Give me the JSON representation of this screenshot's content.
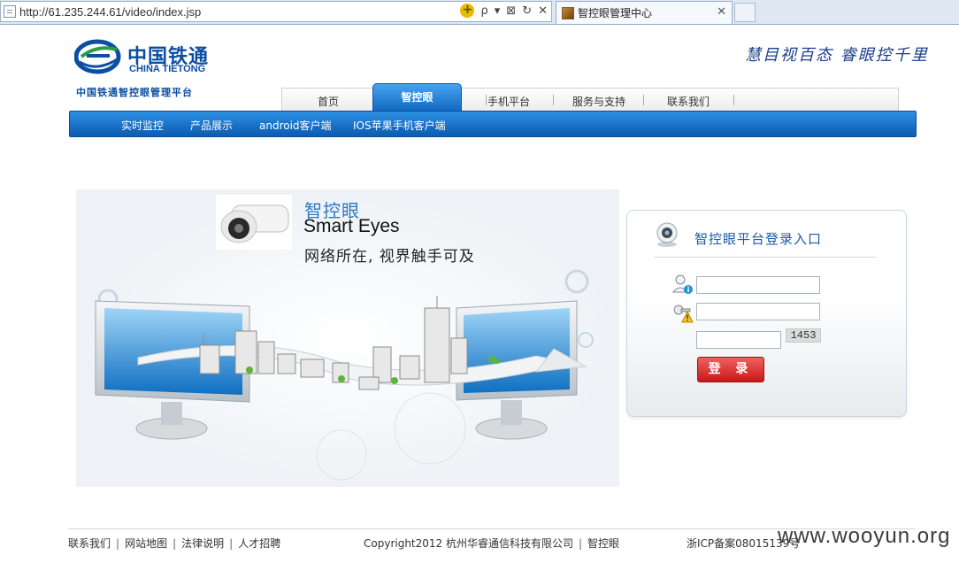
{
  "browser": {
    "url": "http://61.235.244.61/video/index.jsp",
    "tab_title": "智控眼管理中心",
    "compat_label": "+",
    "search_label": "ρ",
    "controls": [
      "⊠",
      "↻",
      "✕"
    ]
  },
  "header": {
    "logo_cn": "中国铁通",
    "logo_en": "CHINA TIETONG",
    "logo_sub": "中国铁通智控眼管理平台",
    "slogan": "慧目视百态 睿眼控千里"
  },
  "top_nav": {
    "items": [
      "首页",
      "智控眼",
      "手机平台",
      "服务与支持",
      "联系我们"
    ],
    "active_index": 1
  },
  "sub_nav": {
    "items": [
      "实时监控",
      "产品展示",
      "android客户端",
      "IOS苹果手机客户端"
    ]
  },
  "hero": {
    "title_cn": "智控眼",
    "title_en": "Smart Eyes",
    "subtitle": "网络所在, 视界触手可及"
  },
  "login": {
    "title": "智控眼平台登录入口",
    "username_value": "",
    "password_value": "",
    "captcha_value": "",
    "captcha_code": "1453",
    "submit_label": "登 录"
  },
  "footer": {
    "links": [
      "联系我们",
      "网站地图",
      "法律说明",
      "人才招聘"
    ],
    "copyright": "Copyright2012  杭州华睿通信科技有限公司",
    "brand": "智控眼",
    "icp": "浙ICP备案08015139号",
    "watermark": "www.wooyun.org"
  },
  "colors": {
    "primary_blue": "#1168c0",
    "brand_blue": "#0b4ea2",
    "login_button": "#c71818"
  }
}
